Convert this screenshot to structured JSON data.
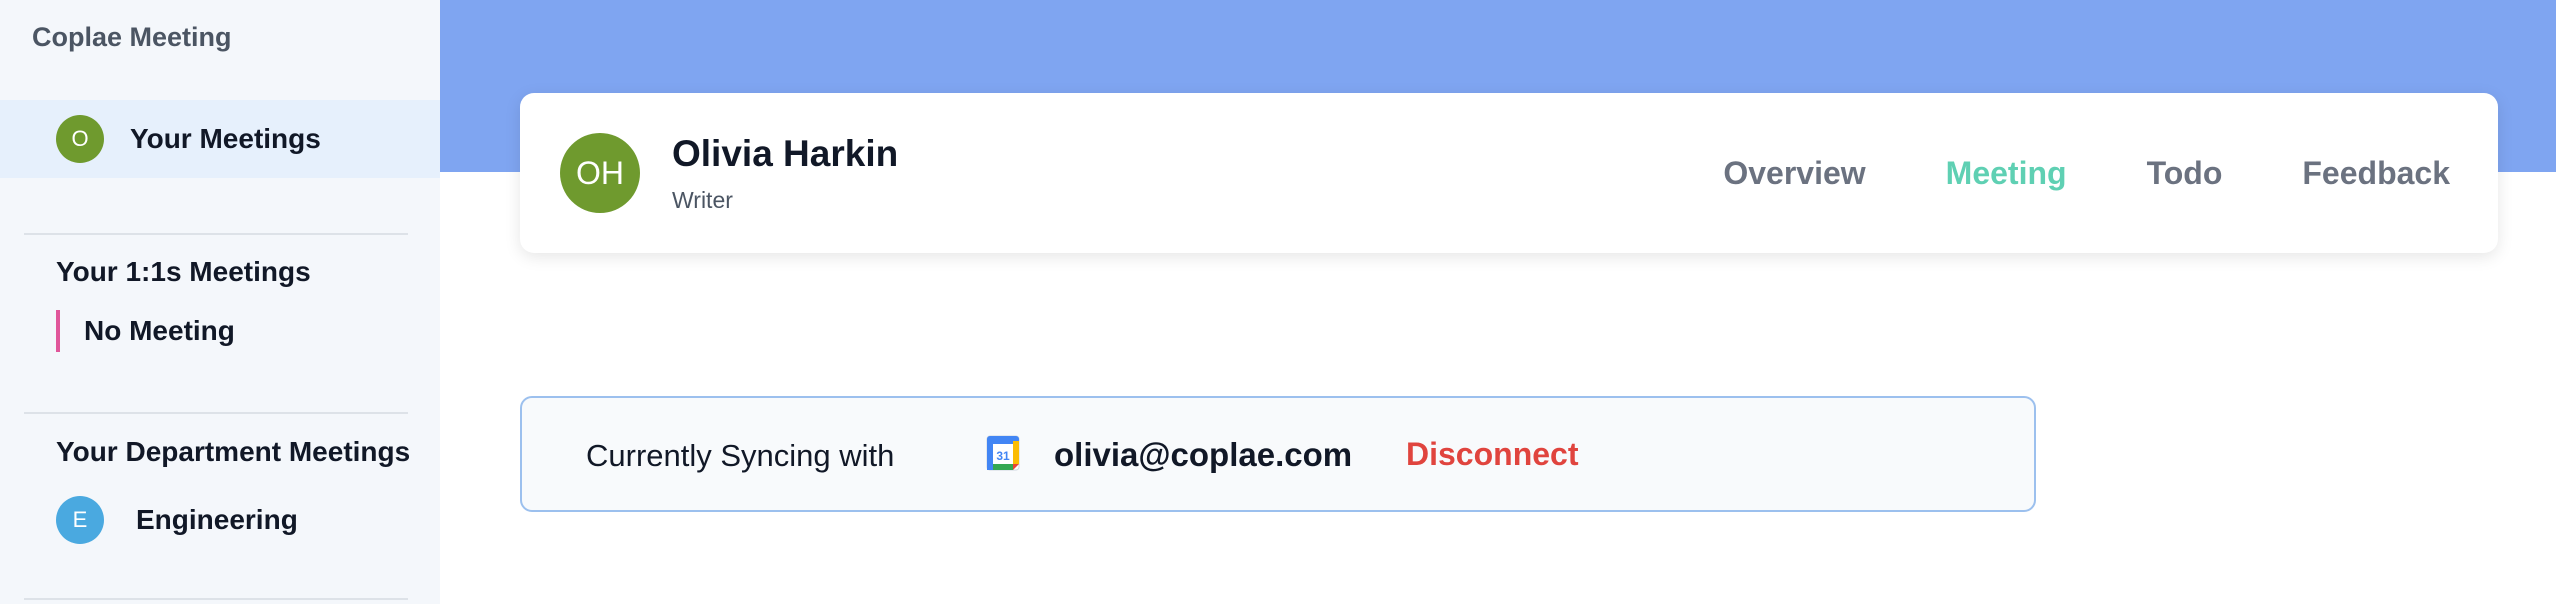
{
  "sidebar": {
    "brand": "Coplae Meeting",
    "active_item": {
      "initial": "O",
      "label": "Your Meetings",
      "color": "#6f9a2e"
    },
    "one_on_one": {
      "title": "Your 1:1s Meetings",
      "empty_label": "No Meeting",
      "accent": "#e0569a"
    },
    "department": {
      "title": "Your Department Meetings",
      "items": [
        {
          "initial": "E",
          "label": "Engineering",
          "color": "#4aa9e0"
        }
      ]
    }
  },
  "banner": {
    "color": "#7fa5f1"
  },
  "profile": {
    "initials": "OH",
    "name": "Olivia Harkin",
    "role": "Writer",
    "avatar_color": "#6f9a2e"
  },
  "tabs": [
    {
      "label": "Overview",
      "active": false
    },
    {
      "label": "Meeting",
      "active": true
    },
    {
      "label": "Todo",
      "active": false
    },
    {
      "label": "Feedback",
      "active": false
    }
  ],
  "sync": {
    "prefix": "Currently Syncing with",
    "calendar_icon": "google-calendar-icon",
    "calendar_day": "31",
    "email": "olivia@coplae.com",
    "action_label": "Disconnect",
    "action_color": "#e0443e"
  }
}
